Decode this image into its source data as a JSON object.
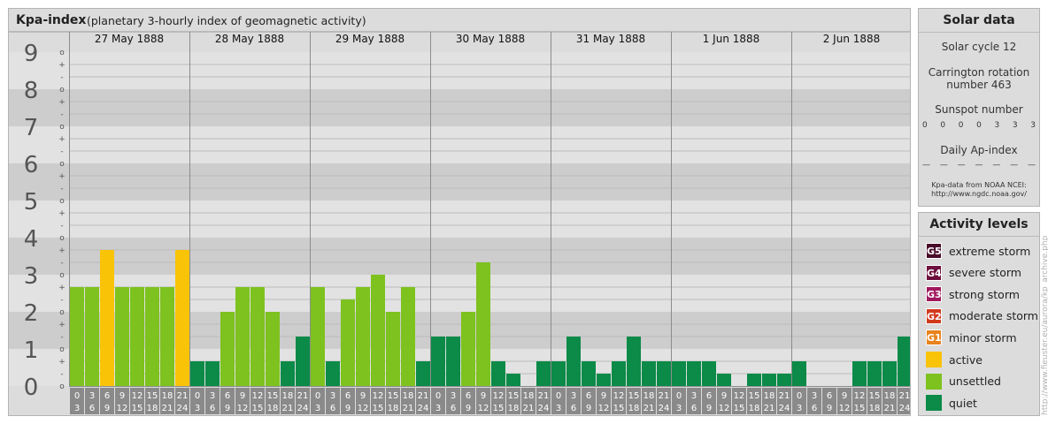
{
  "header": {
    "title": "Kpa-index",
    "subtitle": "(planetary 3-hourly index of geomagnetic activity)"
  },
  "colors": {
    "quiet": "#0b8a48",
    "unsettled": "#7dc21e",
    "active": "#f9c308"
  },
  "chart_data": {
    "type": "bar",
    "y_range": [
      0,
      9
    ],
    "y_tick_labels": [
      "0",
      "1",
      "2",
      "3",
      "4",
      "5",
      "6",
      "7",
      "8",
      "9"
    ],
    "sub_ticks": [
      "o",
      "-",
      "+"
    ],
    "days": [
      "27 May 1888",
      "28 May 1888",
      "29 May 1888",
      "30 May 1888",
      "31 May 1888",
      "1 Jun 1888",
      "2 Jun 1888"
    ],
    "hour_labels_top": [
      "0",
      "3",
      "6",
      "9",
      "12",
      "15",
      "18",
      "21"
    ],
    "hour_labels_bottom": [
      "3",
      "6",
      "9",
      "12",
      "15",
      "18",
      "21",
      "24"
    ],
    "values": [
      [
        2.667,
        2.667,
        3.667,
        2.667,
        2.667,
        2.667,
        2.667,
        3.667
      ],
      [
        0.667,
        0.667,
        2.0,
        2.667,
        2.667,
        2.0,
        0.667,
        1.333
      ],
      [
        2.667,
        0.667,
        2.333,
        2.667,
        3.0,
        2.0,
        2.667,
        0.667
      ],
      [
        1.333,
        1.333,
        2.0,
        3.333,
        0.667,
        0.333,
        0.0,
        0.667
      ],
      [
        0.667,
        1.333,
        0.667,
        0.333,
        0.667,
        1.333,
        0.667,
        0.667
      ],
      [
        0.667,
        0.667,
        0.667,
        0.333,
        0.0,
        0.333,
        0.333,
        0.333
      ],
      [
        0.667,
        0.0,
        0.0,
        0.0,
        0.667,
        0.667,
        0.667,
        1.333
      ]
    ]
  },
  "solar": {
    "title": "Solar data",
    "cycle": "Solar cycle 12",
    "rotation_line1": "Carrington rotation",
    "rotation_line2": "number 463",
    "sunspot_title": "Sunspot number",
    "sunspot_values": [
      "0",
      "0",
      "0",
      "0",
      "3",
      "3",
      "3"
    ],
    "ap_title": "Daily Ap-index",
    "ap_values": [
      "—",
      "—",
      "—",
      "—",
      "—",
      "—",
      "—"
    ],
    "source_line1": "Kpa-data from NOAA NCEI:",
    "source_line2": "http://www.ngdc.noaa.gov/"
  },
  "levels": {
    "title": "Activity levels",
    "items": [
      {
        "code": "G5",
        "label": "extreme storm",
        "color": "#4a0a2a"
      },
      {
        "code": "G4",
        "label": "severe storm",
        "color": "#6d0f3c"
      },
      {
        "code": "G3",
        "label": "strong storm",
        "color": "#a0185e"
      },
      {
        "code": "G2",
        "label": "moderate storm",
        "color": "#d23a1e"
      },
      {
        "code": "G1",
        "label": "minor storm",
        "color": "#e8831e"
      },
      {
        "code": "",
        "label": "active",
        "color": "#f9c308"
      },
      {
        "code": "",
        "label": "unsettled",
        "color": "#7dc21e"
      },
      {
        "code": "",
        "label": "quiet",
        "color": "#0b8a48"
      }
    ]
  },
  "watermark": "http://www.fieuster.eu/aurora/kp_archive.php"
}
